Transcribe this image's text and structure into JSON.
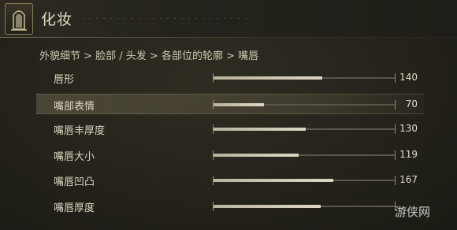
{
  "header": {
    "title": "化妆",
    "emblem_icon": "mirror-emblem-icon"
  },
  "breadcrumb": "外貌细节 > 脸部 / 头发 > 各部位的轮廓 > 嘴唇",
  "sliders": [
    {
      "label": "唇形",
      "value": "140",
      "fill": 0.6,
      "selected": false
    },
    {
      "label": "嘴部表情",
      "value": "70",
      "fill": 0.28,
      "selected": true
    },
    {
      "label": "嘴唇丰厚度",
      "value": "130",
      "fill": 0.51,
      "selected": false
    },
    {
      "label": "嘴唇大小",
      "value": "119",
      "fill": 0.47,
      "selected": false
    },
    {
      "label": "嘴唇凹凸",
      "value": "167",
      "fill": 0.66,
      "selected": false
    },
    {
      "label": "嘴唇厚度",
      "value": "",
      "fill": 0.59,
      "selected": false
    }
  ],
  "watermark": "游侠网"
}
